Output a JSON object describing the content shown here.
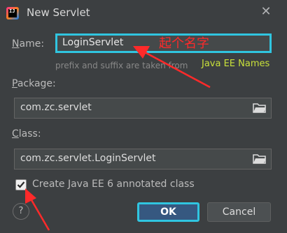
{
  "window": {
    "title": "New Servlet",
    "close_icon": "close-icon"
  },
  "name": {
    "label_mnemonic": "N",
    "label_rest": "ame:",
    "value": "LoginServlet",
    "annotation": "起个名字",
    "hint": "prefix and suffix are taken from",
    "hint_tag": "Java EE Names"
  },
  "package": {
    "label_mnemonic": "P",
    "label_rest": "ackage:",
    "value": "com.zc.servlet"
  },
  "class": {
    "label_mnemonic": "C",
    "label_rest": "lass:",
    "value": "com.zc.servlet.LoginServlet"
  },
  "checkbox": {
    "label": "Create Java EE 6 annotated class",
    "checked": true
  },
  "buttons": {
    "help": "?",
    "ok": "OK",
    "cancel": "Cancel"
  },
  "colors": {
    "annotation_red": "#ff2a2a",
    "focus_cyan": "#30c5e0",
    "hint_tag": "#c8e03a"
  }
}
